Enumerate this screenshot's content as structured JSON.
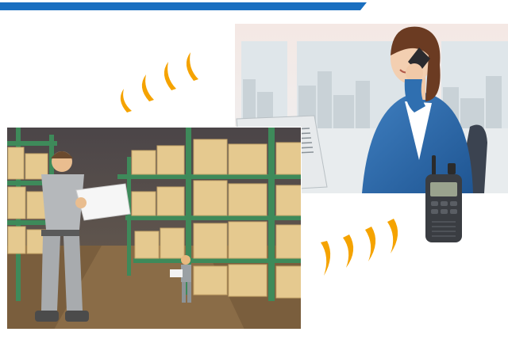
{
  "scene": {
    "banner": {
      "color": "#1a6fc0",
      "text": ""
    },
    "accent_colors": {
      "signal_waves": "#f5a300",
      "office_window": "#dfe6ea",
      "warehouse_floor": "#7a5e3d",
      "shelf_green": "#3e8a5a",
      "box_tan": "#e5c98f",
      "jacket_blue": "#2f6fb0"
    },
    "icons": [
      "radio-signal-icon",
      "walkie-talkie-icon"
    ]
  }
}
